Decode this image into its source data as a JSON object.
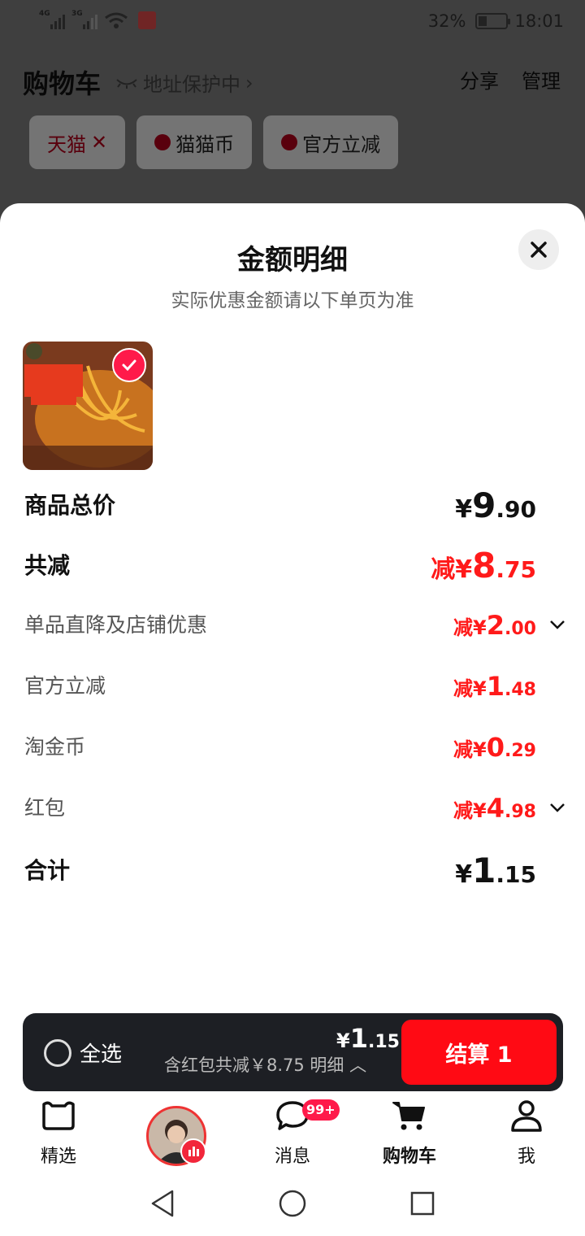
{
  "status_bar": {
    "signal1": "4G",
    "signal2": "3G",
    "battery": "32%",
    "time": "18:01"
  },
  "header": {
    "title": "购物车",
    "address_protect": "地址保护中",
    "share": "分享",
    "manage": "管理"
  },
  "filters": [
    {
      "label": "天猫"
    },
    {
      "label": "猫猫币"
    },
    {
      "label": "官方立减"
    }
  ],
  "sheet": {
    "title": "金额明细",
    "subtitle": "实际优惠金额请以下单页为准",
    "rows": [
      {
        "label": "商品总价",
        "prefix": "",
        "currency": "¥",
        "int": "9",
        "dec": ".90"
      },
      {
        "label": "共减",
        "prefix": "减",
        "currency": "¥",
        "int": "8",
        "dec": ".75"
      },
      {
        "label": "单品直降及店铺优惠",
        "prefix": "减",
        "currency": "¥",
        "int": "2",
        "dec": ".00"
      },
      {
        "label": "官方立减",
        "prefix": "减",
        "currency": "¥",
        "int": "1",
        "dec": ".48"
      },
      {
        "label": "淘金币",
        "prefix": "减",
        "currency": "¥",
        "int": "0",
        "dec": ".29"
      },
      {
        "label": "红包",
        "prefix": "减",
        "currency": "¥",
        "int": "4",
        "dec": ".98"
      },
      {
        "label": "合计",
        "prefix": "",
        "currency": "¥",
        "int": "1",
        "dec": ".15"
      }
    ]
  },
  "bottom_bar": {
    "select_all": "全选",
    "total": {
      "currency": "¥",
      "int": "1",
      "dec": ".15"
    },
    "discount_note": "含红包共减￥8.75 明细",
    "checkout": "结算 1"
  },
  "tabs": [
    {
      "label": "精选"
    },
    {
      "label": "消息",
      "badge": "99+"
    },
    {
      "label": "购物车"
    },
    {
      "label": "我"
    }
  ],
  "colors": {
    "accent_red": "#ff1a1a",
    "checkout_red": "#ff0a14",
    "dark_bar": "#1d1f24"
  }
}
